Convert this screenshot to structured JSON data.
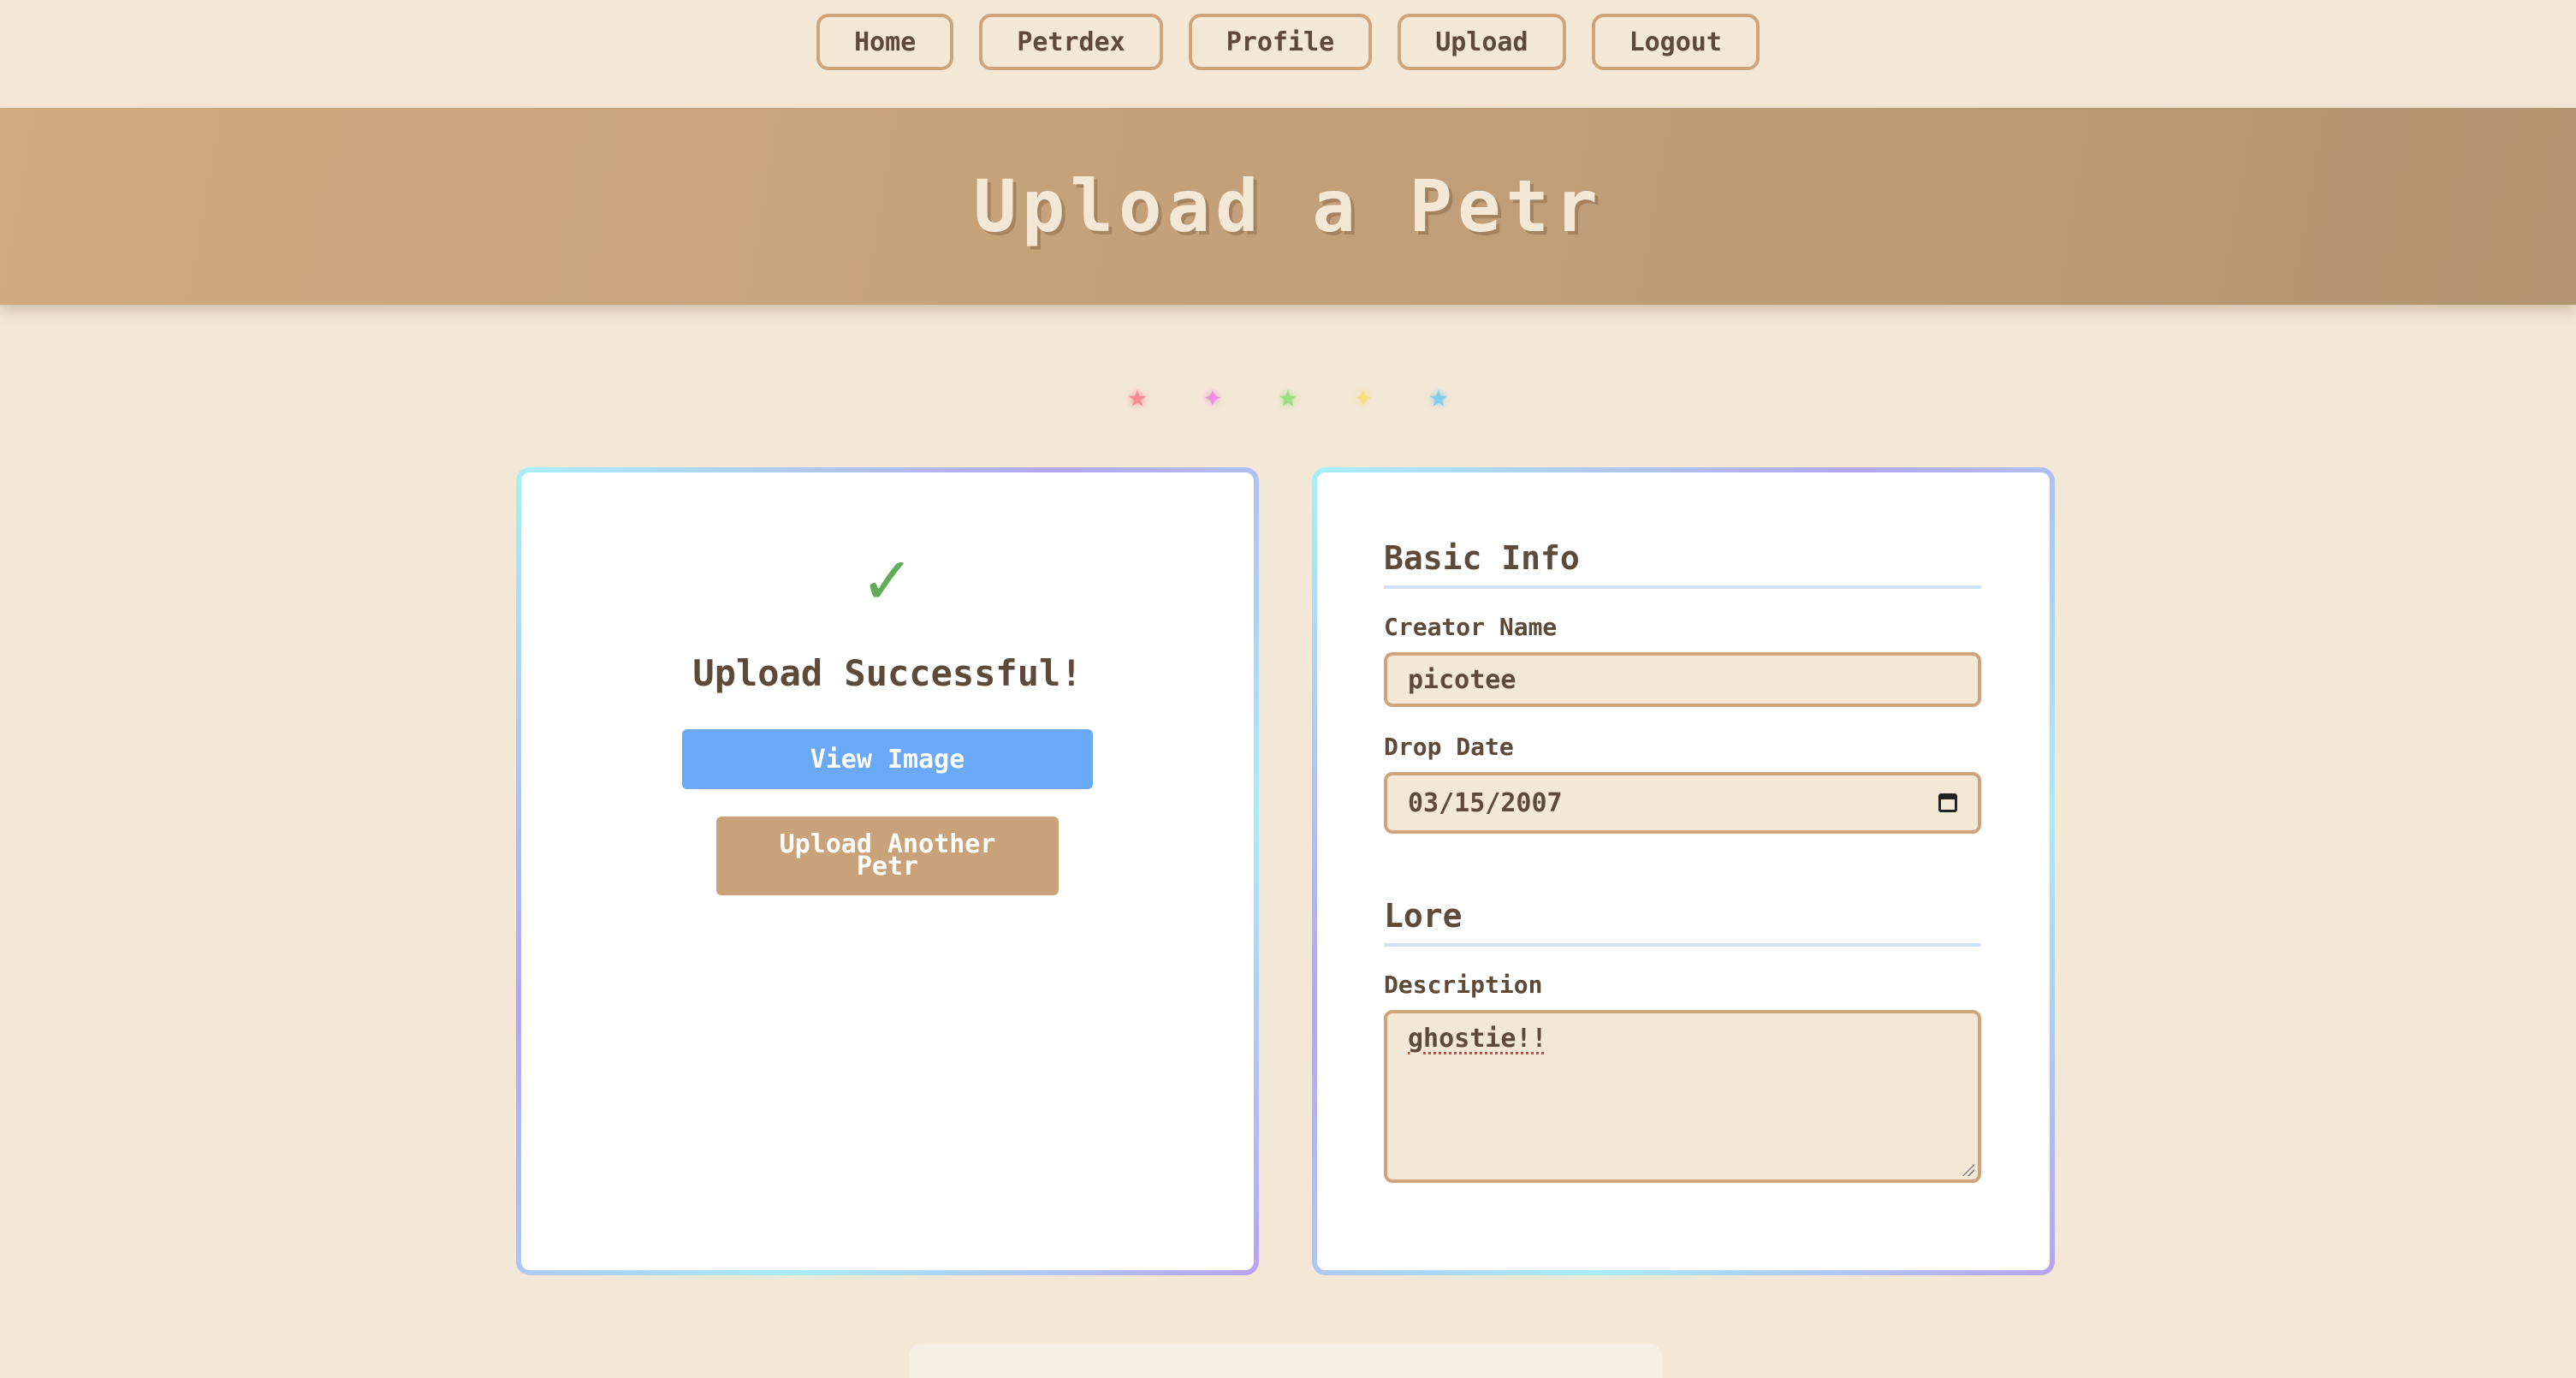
{
  "nav": {
    "items": [
      {
        "label": "Home"
      },
      {
        "label": "Petrdex"
      },
      {
        "label": "Profile"
      },
      {
        "label": "Upload"
      },
      {
        "label": "Logout"
      }
    ]
  },
  "header": {
    "title": "Upload a Petr"
  },
  "stars": [
    {
      "glyph": "★",
      "color": "#f78a95"
    },
    {
      "glyph": "✦",
      "color": "#ef8ee0"
    },
    {
      "glyph": "★",
      "color": "#9be07f"
    },
    {
      "glyph": "✦",
      "color": "#f7dd7f"
    },
    {
      "glyph": "★",
      "color": "#82cdea"
    }
  ],
  "status": {
    "check": "✓",
    "title": "Upload Successful!",
    "view_button": "View Image",
    "upload_another_button": "Upload Another Petr"
  },
  "form": {
    "basic_info": {
      "title": "Basic Info",
      "creator_label": "Creator Name",
      "creator_value": "picotee",
      "date_label": "Drop Date",
      "date_value": "03/15/2007"
    },
    "lore": {
      "title": "Lore",
      "description_label": "Description",
      "description_value": "ghostie!!"
    }
  },
  "colors": {
    "background": "#f3e7d6",
    "banner": "#c3a07a",
    "accent_blue": "#6aa9f5",
    "accent_tan": "#c9a27a",
    "success_green": "#5fae55"
  }
}
